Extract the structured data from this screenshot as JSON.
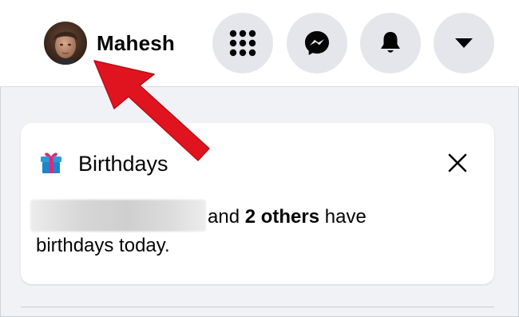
{
  "header": {
    "profile_name": "Mahesh",
    "buttons": [
      {
        "name": "menu",
        "icon": "grid-dots-icon"
      },
      {
        "name": "messenger",
        "icon": "messenger-icon"
      },
      {
        "name": "notifications",
        "icon": "bell-icon"
      },
      {
        "name": "account",
        "icon": "caret-down-icon"
      }
    ]
  },
  "birthdays_card": {
    "title": "Birthdays",
    "icon": "gift-icon",
    "text_middle": "and",
    "text_bold": "2 others",
    "text_end": "have",
    "text_line2": "birthdays today."
  },
  "colors": {
    "accent_arrow": "#e0141e",
    "button_bg": "#e4e6eb",
    "page_bg": "#f0f2f5"
  }
}
